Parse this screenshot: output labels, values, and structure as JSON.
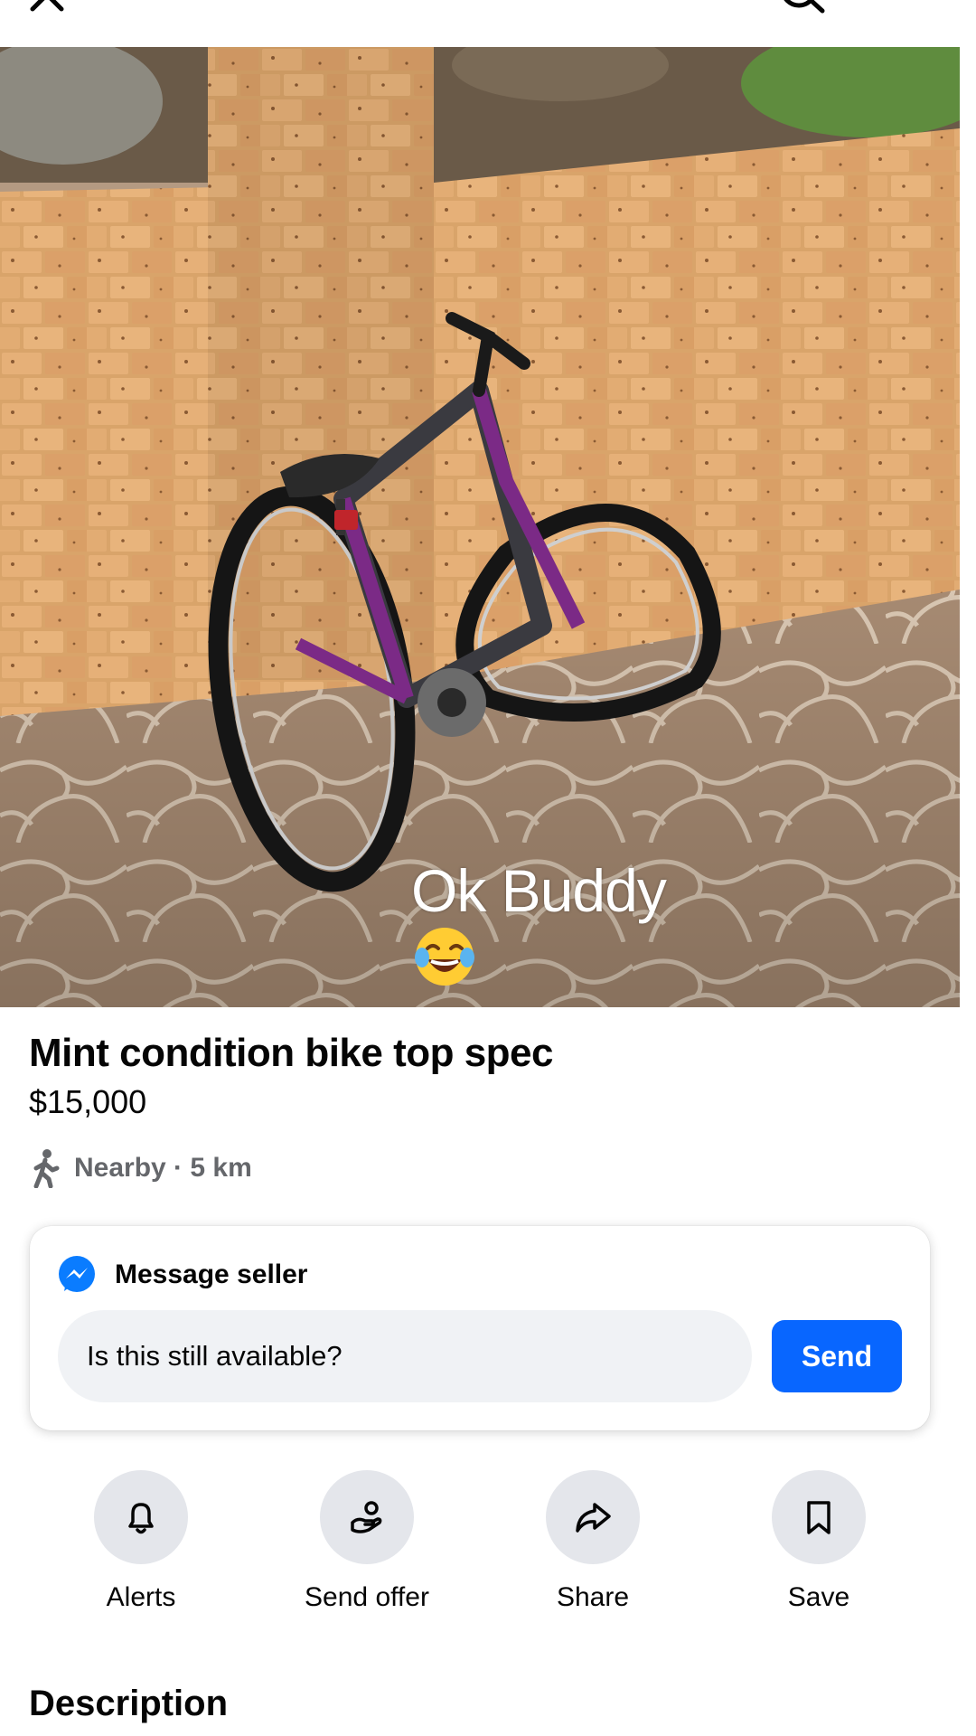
{
  "photo": {
    "caption": "Ok Buddy",
    "caption_emoji": "face-with-tears-of-joy"
  },
  "listing": {
    "title": "Mint condition bike top spec",
    "price": "$15,000",
    "distance": "Nearby · 5 km"
  },
  "message": {
    "header": "Message seller",
    "input_value": "Is this still available?",
    "send_label": "Send"
  },
  "actions": [
    {
      "label": "Alerts",
      "icon": "bell-icon"
    },
    {
      "label": "Send offer",
      "icon": "offer-hand-icon"
    },
    {
      "label": "Share",
      "icon": "share-arrow-icon"
    },
    {
      "label": "Save",
      "icon": "bookmark-icon"
    }
  ],
  "description": {
    "heading": "Description"
  },
  "colors": {
    "accent": "#0866ff",
    "secondary_text": "#65676b",
    "circle_bg": "#e4e6eb",
    "input_bg": "#f0f2f5"
  }
}
